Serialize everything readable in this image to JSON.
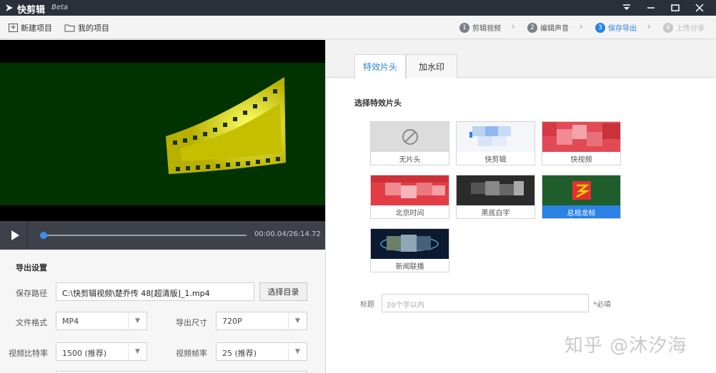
{
  "titlebar": {
    "title": "快剪辑",
    "beta": "Beta",
    "icons": [
      "logo-icon",
      "dropdown-icon",
      "minimize-icon",
      "maximize-icon",
      "close-icon"
    ]
  },
  "toolbar": {
    "new_project": "新建项目",
    "my_projects": "我的项目",
    "steps": [
      {
        "num": "1",
        "label": "剪辑视频",
        "state": "done"
      },
      {
        "num": "2",
        "label": "编辑声音",
        "state": "done"
      },
      {
        "num": "3",
        "label": "保存导出",
        "state": "active"
      },
      {
        "num": "4",
        "label": "上传分享",
        "state": "disabled"
      }
    ]
  },
  "player": {
    "time": "00:00.04/26:14.72",
    "progress": 0.0
  },
  "export": {
    "heading": "导出设置",
    "save_path_label": "保存路径",
    "save_path_value": "C:\\快剪辑视频\\楚乔传 48[超清版]_1.mp4",
    "choose_dir_button": "选择目录",
    "format_label": "文件格式",
    "format_value": "MP4",
    "size_label": "导出尺寸",
    "size_value": "720P",
    "bitrate_label": "视频比特率",
    "bitrate_value": "1500 (推荐)",
    "framerate_label": "视频帧率",
    "framerate_value": "25 (推荐)"
  },
  "right": {
    "tabs": [
      "特效片头",
      "加水印"
    ],
    "section_title": "选择特效片头",
    "cards": [
      {
        "label": "无片头",
        "selected": false
      },
      {
        "label": "快剪辑",
        "selected": false
      },
      {
        "label": "快视频",
        "selected": false
      },
      {
        "label": "北京时间",
        "selected": false
      },
      {
        "label": "黑底白字",
        "selected": false
      },
      {
        "label": "总局龙标",
        "selected": true
      },
      {
        "label": "新闻联播",
        "selected": false
      }
    ],
    "title_label": "标题",
    "title_placeholder": "20个字以内",
    "required_note": "*必填"
  },
  "watermark": "知乎 @沐汐海",
  "colors": {
    "accent": "#2a82e4",
    "titlebar": "#2b2f3a",
    "preview_bg": "#003300",
    "film_yellow": "#d6d400"
  }
}
